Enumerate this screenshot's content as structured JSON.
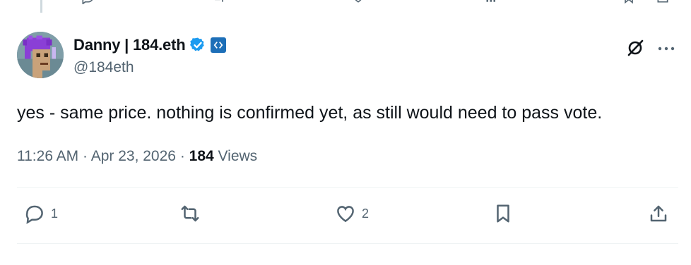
{
  "user": {
    "display_name": "Danny | 184.eth",
    "handle": "@184eth",
    "verified": true,
    "avatar_icon": "cryptopunk-avatar-icon",
    "affiliate_badge_icon": "code-brackets-badge-icon"
  },
  "tweet": {
    "text": "yes - same price. nothing is confirmed yet, as still would need to pass vote.",
    "time": "11:26 AM",
    "separator": "·",
    "date": "Apr 23, 2026",
    "views_count": "184",
    "views_label": "Views"
  },
  "actions": {
    "reply_count": "1",
    "retweet_count": "",
    "like_count": "2"
  },
  "colors": {
    "text": "#0f1419",
    "muted": "#536471",
    "verified": "#1d9bf0",
    "divider": "#eff3f4"
  }
}
